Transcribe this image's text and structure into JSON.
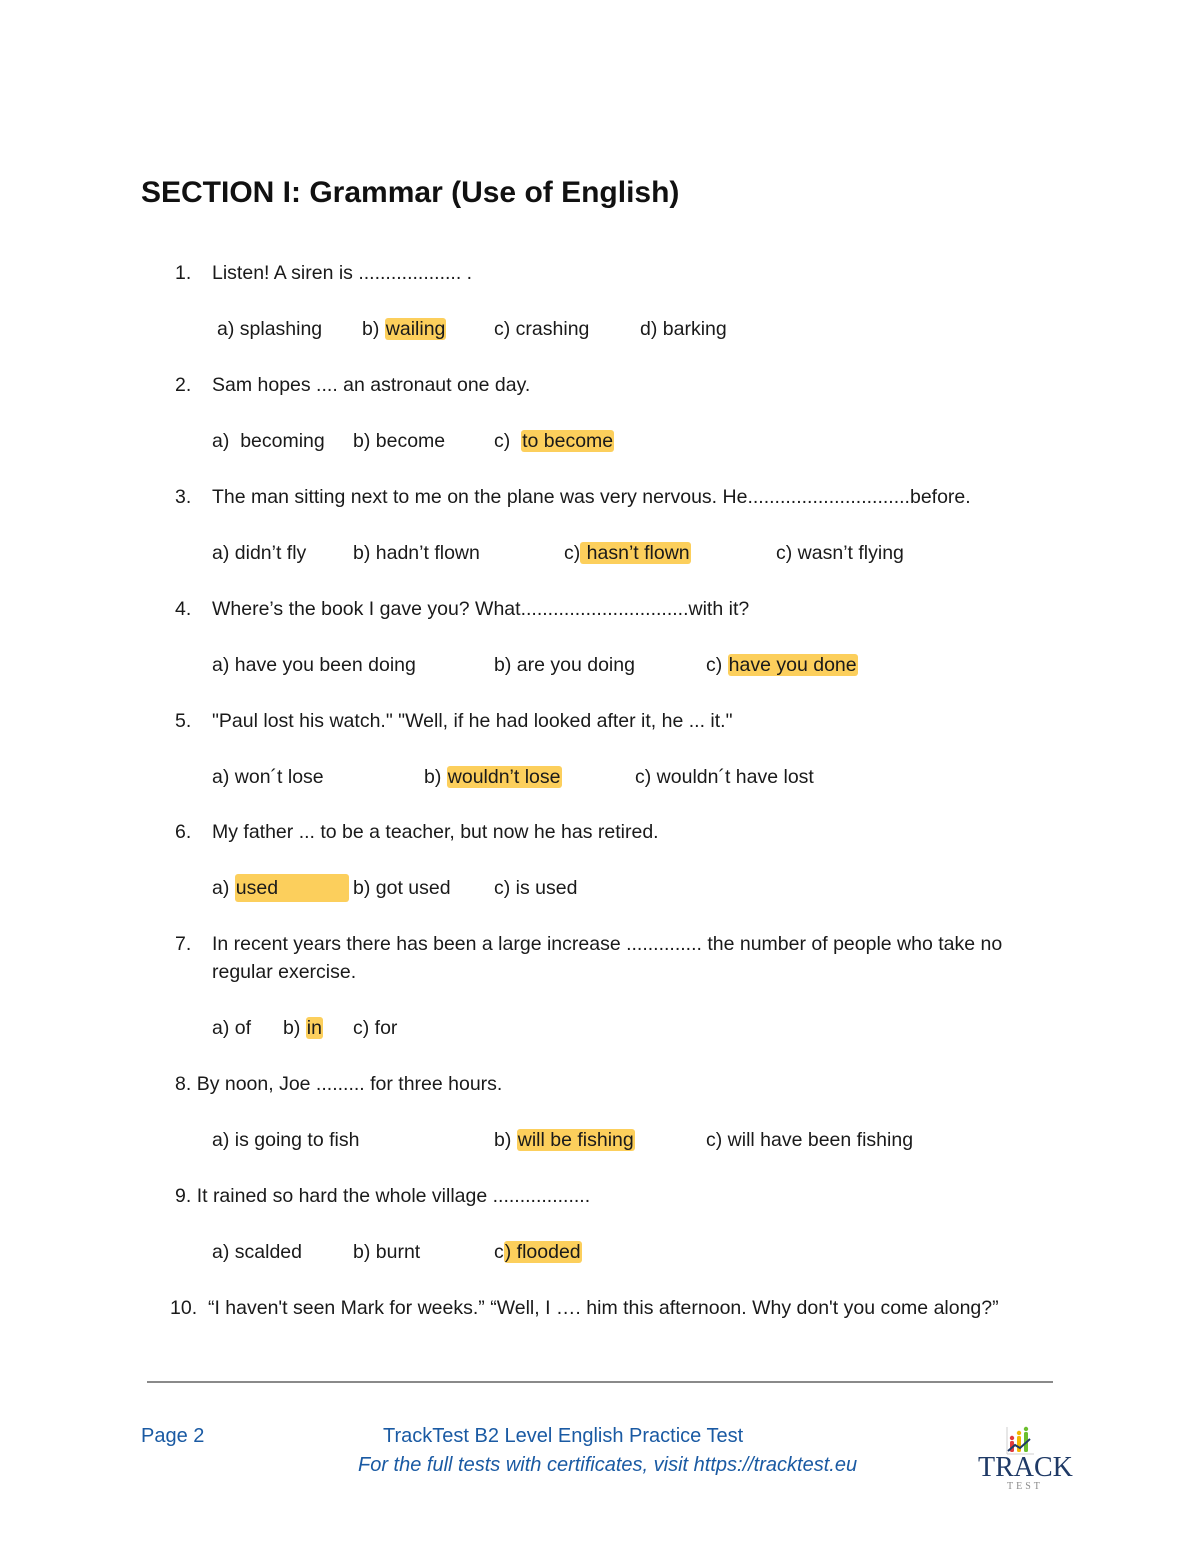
{
  "section": {
    "title": "SECTION I: Grammar (Use of English)"
  },
  "questions": [
    {
      "number": "1.",
      "text": "Listen! A siren is ................... .",
      "options": [
        {
          "label": "a)",
          "text": "splashing",
          "highlighted": false
        },
        {
          "label": "b)",
          "text": "wailing",
          "highlighted": true
        },
        {
          "label": "c)",
          "text": "crashing",
          "highlighted": false
        },
        {
          "label": "d)",
          "text": "barking",
          "highlighted": false
        }
      ]
    },
    {
      "number": "2.",
      "text": "Sam hopes .... an astronaut one day.",
      "options": [
        {
          "label": "a)",
          "text": "becoming",
          "highlighted": false
        },
        {
          "label": "b)",
          "text": "become",
          "highlighted": false
        },
        {
          "label": "c)",
          "text": "to become",
          "highlighted": true
        }
      ]
    },
    {
      "number": "3.",
      "text": "The man sitting next to me on the plane was very nervous. He..............................before.",
      "options": [
        {
          "label": "a)",
          "text": "didn’t fly",
          "highlighted": false
        },
        {
          "label": "b)",
          "text": "hadn’t flown",
          "highlighted": false
        },
        {
          "label": "c)",
          "text": " hasn’t flown",
          "highlighted": true
        },
        {
          "label": "c)",
          "text": "wasn’t flying",
          "highlighted": false
        }
      ]
    },
    {
      "number": "4.",
      "text": "Where’s the book I gave you? What...............................with it?",
      "options": [
        {
          "label": "a)",
          "text": "have you been doing",
          "highlighted": false
        },
        {
          "label": "b)",
          "text": "are you doing",
          "highlighted": false
        },
        {
          "label": "c)",
          "text": "have you done",
          "highlighted": true
        }
      ]
    },
    {
      "number": "5.",
      "text": " \"Paul lost his watch.\" \"Well, if he had looked after it, he ... it.\"",
      "options": [
        {
          "label": "a)",
          "text": "won´t lose",
          "highlighted": false
        },
        {
          "label": "b)",
          "text": "wouldn’t lose",
          "highlighted": true
        },
        {
          "label": "c)",
          "text": "wouldn´t have lost",
          "highlighted": false
        }
      ]
    },
    {
      "number": "6.",
      "text": "My father ... to be a teacher, but now he has retired.",
      "options": [
        {
          "label": "a)",
          "text": "used",
          "highlighted": true
        },
        {
          "label": "b)",
          "text": "got used",
          "highlighted": false
        },
        {
          "label": "c)",
          "text": "is used",
          "highlighted": false
        }
      ]
    },
    {
      "number": "7.",
      "text": "In recent years there has been a large increase .............. the number of people who take no regular exercise.",
      "options": [
        {
          "label": "a)",
          "text": "of",
          "highlighted": false
        },
        {
          "label": "b)",
          "text": "in",
          "highlighted": true
        },
        {
          "label": "c)",
          "text": "for",
          "highlighted": false
        }
      ]
    },
    {
      "number": "8.",
      "text": "By noon, Joe ......... for three hours.",
      "options": [
        {
          "label": "a)",
          "text": "is going to fish",
          "highlighted": false
        },
        {
          "label": "b)",
          "text": "will be fishing",
          "highlighted": true
        },
        {
          "label": "c)",
          "text": "will have been fishing",
          "highlighted": false
        }
      ]
    },
    {
      "number": "9.",
      "text": "It rained so hard the whole village ..................",
      "options": [
        {
          "label": "a)",
          "text": "scalded",
          "highlighted": false
        },
        {
          "label": "b)",
          "text": "burnt",
          "highlighted": false
        },
        {
          "label": "c",
          "text": ") flooded",
          "highlighted": true
        }
      ]
    },
    {
      "number": "10.",
      "text": "“I haven't seen Mark for weeks.” “Well, I …. him this afternoon. Why don't you come along?”"
    }
  ],
  "footer": {
    "page": "Page 2",
    "title": "TrackTest B2 Level English Practice Test",
    "subtitle": "For the full tests with certificates, visit https://tracktest.eu",
    "logo_word": "TRACK",
    "logo_sub": "TEST",
    "logo_icon": "bar-chart-people-icon",
    "color": "#1a5aa3"
  },
  "colors": {
    "highlight": "#fccf5c",
    "logo_navy": "#1f3a66"
  }
}
